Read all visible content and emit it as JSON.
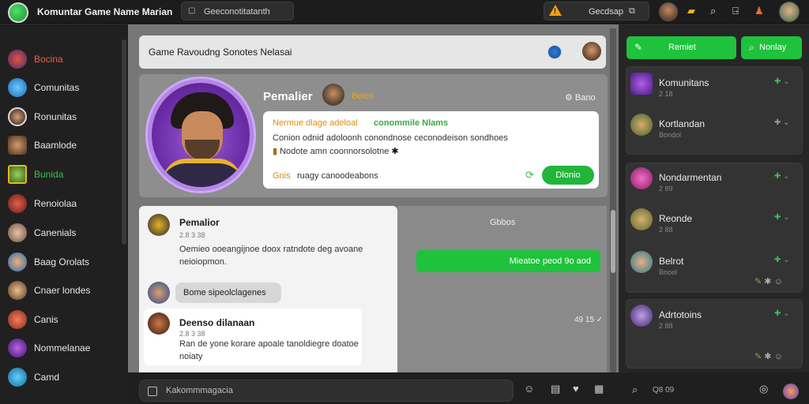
{
  "topbar": {
    "title": "Komuntar Game Name Marian",
    "search_placeholder": "Geeconotitatanth",
    "alert_text": "Gecdsap",
    "alert_icon": "warning-icon",
    "icons": [
      "screen-icon",
      "avatar",
      "folder-icon",
      "search-icon",
      "exit-icon",
      "notification-icon",
      "profile-avatar"
    ]
  },
  "sidebar": {
    "items": [
      {
        "label": "Bocina"
      },
      {
        "label": "Comunitas"
      },
      {
        "label": "Ronunitas"
      },
      {
        "label": "Baamlode"
      },
      {
        "label": "Bunida"
      },
      {
        "label": "Renoiolaa"
      },
      {
        "label": "Canenials"
      },
      {
        "label": "Baag Orolats"
      },
      {
        "label": "Cnaer londes"
      },
      {
        "label": "Canis"
      },
      {
        "label": "Nommelanae"
      },
      {
        "label": "Camd"
      }
    ]
  },
  "header": {
    "title": "Game Ravoudng Sonotes Nelasai"
  },
  "profile": {
    "name": "Pemalier",
    "status": "Beicn",
    "right_label": "Bano",
    "info": {
      "line1_orange": "Nermue dlage adeloal",
      "line1_green": "conommile Nlams",
      "line2": "Conion odnid adoloonh conondnose ceconodeison sondhoes",
      "line3": "Nodote amn coonnorsolotne",
      "line4_orange": "Gnis",
      "line4_text": "ruagy canoodeabons",
      "button_label": "Dlonio"
    }
  },
  "chat": {
    "messages": [
      {
        "name": "Pemalior",
        "meta": "2.8 3 38",
        "text": "Oemieo ooeangijnoe doox ratndote deg avoane neioiopmon."
      },
      {
        "name": "Deenso dilanaan",
        "meta": "2.8 3 38",
        "text": "Ran de yone korare apoale tanoldiegre doatoe noiaty"
      }
    ],
    "pill_text": "Bome sipeolclagenes",
    "right_label": "Gbbos",
    "green_message": "Mieatoe peod 9o aod",
    "right_time": "49 15"
  },
  "composer": {
    "placeholder": "Kakommmagacia",
    "search_text": "Q8 09"
  },
  "right_panel": {
    "button1": "Remiet",
    "button2": "Nonlay",
    "groups": [
      {
        "items": [
          {
            "name": "Komunitans",
            "sub": "2 18"
          },
          {
            "name": "Kortlandan",
            "sub": "Bondol"
          }
        ]
      },
      {
        "items": [
          {
            "name": "Nondarmentan",
            "sub": "2 89"
          },
          {
            "name": "Reonde",
            "sub": "2 88"
          },
          {
            "name": "Belrot",
            "sub": "Bnoel"
          }
        ]
      },
      {
        "items": [
          {
            "name": "Adrtotoins",
            "sub": "2 88"
          }
        ]
      }
    ]
  },
  "colors": {
    "accent_green": "#1fc23c",
    "warning_orange": "#f0a019",
    "status_orange": "#e08c0f",
    "avatar_purple": "#9b5bd6"
  }
}
